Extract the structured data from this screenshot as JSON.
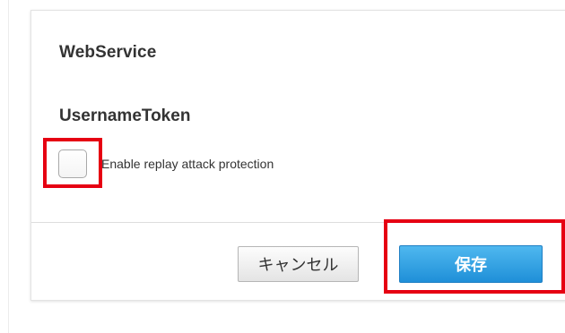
{
  "dialog": {
    "title": "WebService",
    "section": "UsernameToken",
    "checkbox": {
      "label": "Enable replay attack protection",
      "checked": false
    }
  },
  "footer": {
    "cancel_label": "キャンセル",
    "save_label": "保存"
  },
  "colors": {
    "highlight": "#e60012",
    "primary_button": "#2a9be0",
    "text": "#333333"
  }
}
